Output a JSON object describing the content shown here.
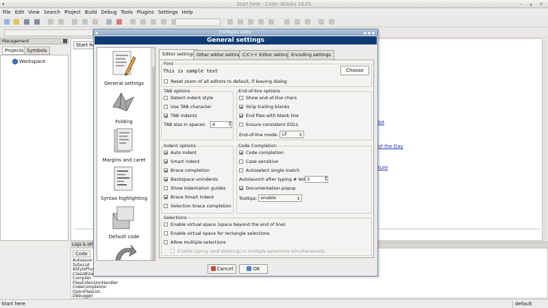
{
  "window": {
    "title": "Start here - Code::Blocks 16.01",
    "menu": [
      "File",
      "Edit",
      "View",
      "Search",
      "Project",
      "Build",
      "Debug",
      "Tools",
      "Plugins",
      "Settings",
      "Help"
    ]
  },
  "management": {
    "title": "Management",
    "tabs": [
      "Projects",
      "Symbols"
    ],
    "tree_root": "Workspace"
  },
  "editor": {
    "tab": "Start here",
    "links": [
      "bit",
      "of the Day",
      "ture"
    ]
  },
  "logs": {
    "title": "Logs & others",
    "tab": "Code",
    "lines": [
      "Autosave",
      "ToDoList",
      "AStylePlugin",
      "ClassWizard",
      "Compiler",
      "FilesExtensionHandler",
      "CodeCompletion",
      "OpenFilesList",
      "Debugger"
    ]
  },
  "statusbar": {
    "left": "Start here",
    "right": "default"
  },
  "dialog": {
    "title": "Configure editor",
    "header": "General settings",
    "categories": [
      "General settings",
      "Folding",
      "Margins and caret",
      "Syntax highlighting",
      "Default code"
    ],
    "tabs": [
      "Editor settings",
      "Other editor settings",
      "C/C++ Editor settings",
      "Encoding settings"
    ],
    "font": {
      "title": "Font",
      "sample": "This is sample text",
      "choose_label": "Choose",
      "reset_zoom": {
        "label": "Reset zoom of all editors to default, if leaving dialog",
        "checked": false
      }
    },
    "tab_options": {
      "title": "TAB options",
      "items": [
        {
          "label": "Detect indent style",
          "checked": false
        },
        {
          "label": "Use TAB character",
          "checked": false
        },
        {
          "label": "TAB indents",
          "checked": true
        }
      ],
      "size_label": "TAB size in spaces:",
      "size_value": "4"
    },
    "eol_options": {
      "title": "End-of-line options",
      "items": [
        {
          "label": "Show end-of-line chars",
          "checked": false
        },
        {
          "label": "Strip trailing blanks",
          "checked": true
        },
        {
          "label": "End files with blank line",
          "checked": true
        },
        {
          "label": "Ensure consistent EOLs",
          "checked": false
        }
      ],
      "mode_label": "End-of-line mode:",
      "mode_value": "LF"
    },
    "indent_options": {
      "title": "Indent options",
      "items": [
        {
          "label": "Auto indent",
          "checked": true
        },
        {
          "label": "Smart indent",
          "checked": true
        },
        {
          "label": "Brace completion",
          "checked": true
        },
        {
          "label": "Backspace unindents",
          "checked": true
        },
        {
          "label": "Show indentation guides",
          "checked": false
        },
        {
          "label": "Brace Smart Indent",
          "checked": true
        },
        {
          "label": "Selection brace completion",
          "checked": false
        }
      ]
    },
    "code_completion": {
      "title": "Code Completion",
      "items": [
        {
          "label": "Code completion",
          "checked": true
        },
        {
          "label": "Case sensitive",
          "checked": false
        },
        {
          "label": "Autoselect single match",
          "checked": false
        }
      ],
      "autolaunch_label": "Autolaunch after typing # letters:",
      "autolaunch_value": "3",
      "doc_popup": {
        "label": "Documentation popup",
        "checked": true
      },
      "tooltips_label": "Tooltips:",
      "tooltips_value": "enable"
    },
    "selections": {
      "title": "Selections",
      "items": [
        {
          "label": "Enable virtual space (space beyond the end of line)",
          "checked": false
        },
        {
          "label": "Enable virtual space for rectangle selections",
          "checked": false
        },
        {
          "label": "Allow multiple selections",
          "checked": false
        }
      ],
      "disabled_item": {
        "label": "Enable typing (and deleting) in multiple selections simultaneously",
        "checked": false
      }
    },
    "buttons": {
      "cancel": "Cancel",
      "ok": "OK"
    }
  }
}
